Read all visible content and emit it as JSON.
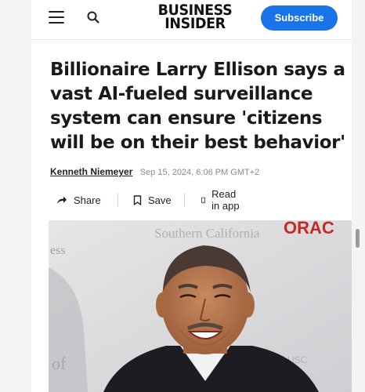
{
  "header": {
    "logo_line1": "BUSINESS",
    "logo_line2": "INSIDER",
    "subscribe_label": "Subscribe",
    "menu_icon": "hamburger-menu-icon",
    "search_icon": "search-icon"
  },
  "article": {
    "headline": "Billionaire Larry Ellison says a vast AI-fueled surveillance system can ensure 'citizens will be on their best behavior'",
    "author": "Kenneth Niemeyer",
    "date": "Sep 15, 2024, 6:06 PM GMT+2"
  },
  "actions": {
    "share_label": "Share",
    "save_label": "Save",
    "read_in_app_label": "Read in app"
  },
  "photo": {
    "backdrop_text_1": "Southern California",
    "backdrop_text_2": "ORAC",
    "backdrop_text_3": "ess",
    "backdrop_text_4": "of",
    "backdrop_text_5": "USC"
  },
  "colors": {
    "subscribe_bg": "#1a73e8",
    "backdrop_red": "#c62828"
  }
}
